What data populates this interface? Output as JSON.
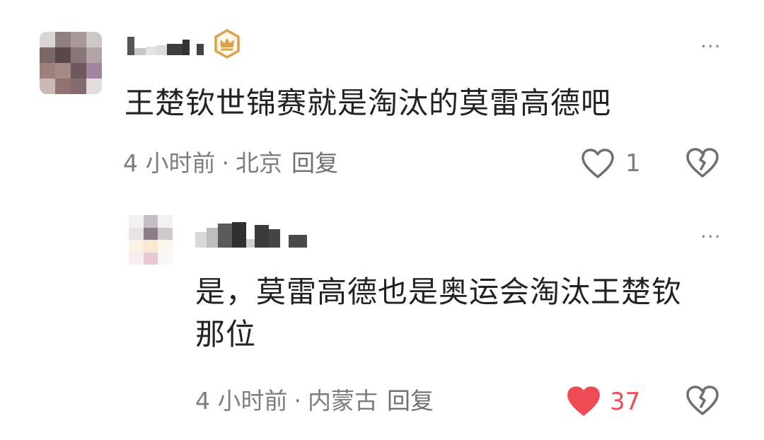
{
  "colors": {
    "text": "#222222",
    "meta": "#7d7d7d",
    "like_active": "#ee4b55",
    "icon": "#707070",
    "badge": "#d7a24b"
  },
  "comments": [
    {
      "icons": {
        "badge": "crown-badge-icon",
        "more": "more-options-icon",
        "like": "heart-outline-icon",
        "dislike": "broken-heart-icon"
      },
      "text": "王楚钦世锦赛就是淘汰的莫雷高德吧",
      "time": "4 小时前",
      "separator": "·",
      "location": "北京",
      "reply_label": "回复",
      "likes": "1",
      "liked": false,
      "more_label": "···"
    },
    {
      "icons": {
        "more": "more-options-icon",
        "like": "heart-filled-icon",
        "dislike": "broken-heart-icon"
      },
      "text_line1": "是，莫雷高德也是奥运会淘汰王楚钦",
      "text_line2": "那位",
      "time": "4 小时前",
      "separator": "·",
      "location": "内蒙古",
      "reply_label": "回复",
      "likes": "37",
      "liked": true,
      "more_label": "···"
    }
  ]
}
